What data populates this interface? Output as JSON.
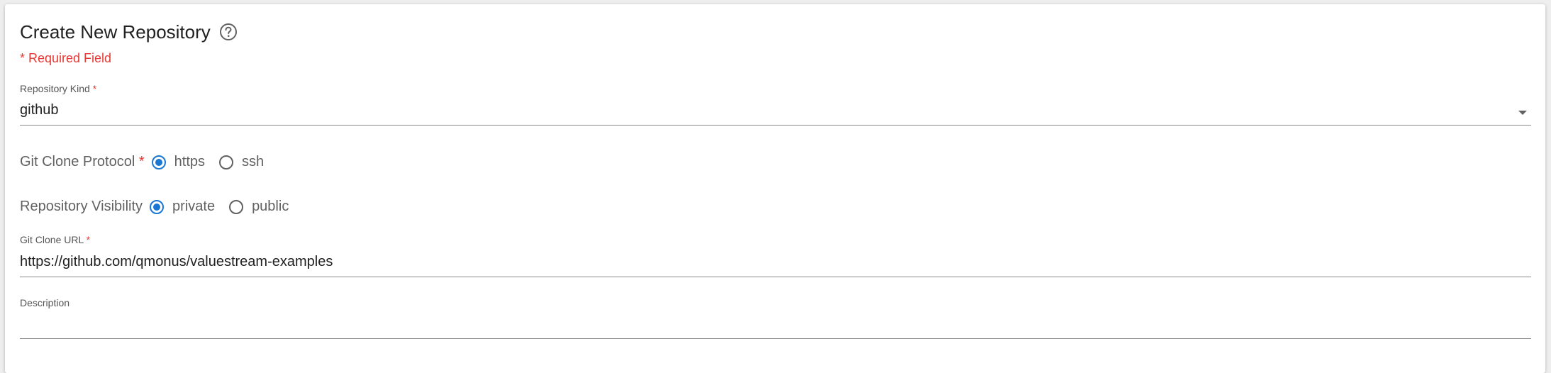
{
  "form": {
    "title": "Create New Repository",
    "help_icon": "help-circle-icon",
    "required_note": "* Required Field",
    "repository_kind": {
      "label": "Repository Kind",
      "required_mark": "*",
      "value": "github"
    },
    "git_clone_protocol": {
      "label": "Git Clone Protocol",
      "required_mark": "*",
      "options": [
        "https",
        "ssh"
      ],
      "selected": "https"
    },
    "repository_visibility": {
      "label": "Repository Visibility",
      "options": [
        "private",
        "public"
      ],
      "selected": "private"
    },
    "git_clone_url": {
      "label": "Git Clone URL",
      "required_mark": "*",
      "value": "https://github.com/qmonus/valuestream-examples"
    },
    "description": {
      "label": "Description",
      "value": ""
    }
  },
  "colors": {
    "accent": "#1976d2",
    "required": "#e53935"
  }
}
